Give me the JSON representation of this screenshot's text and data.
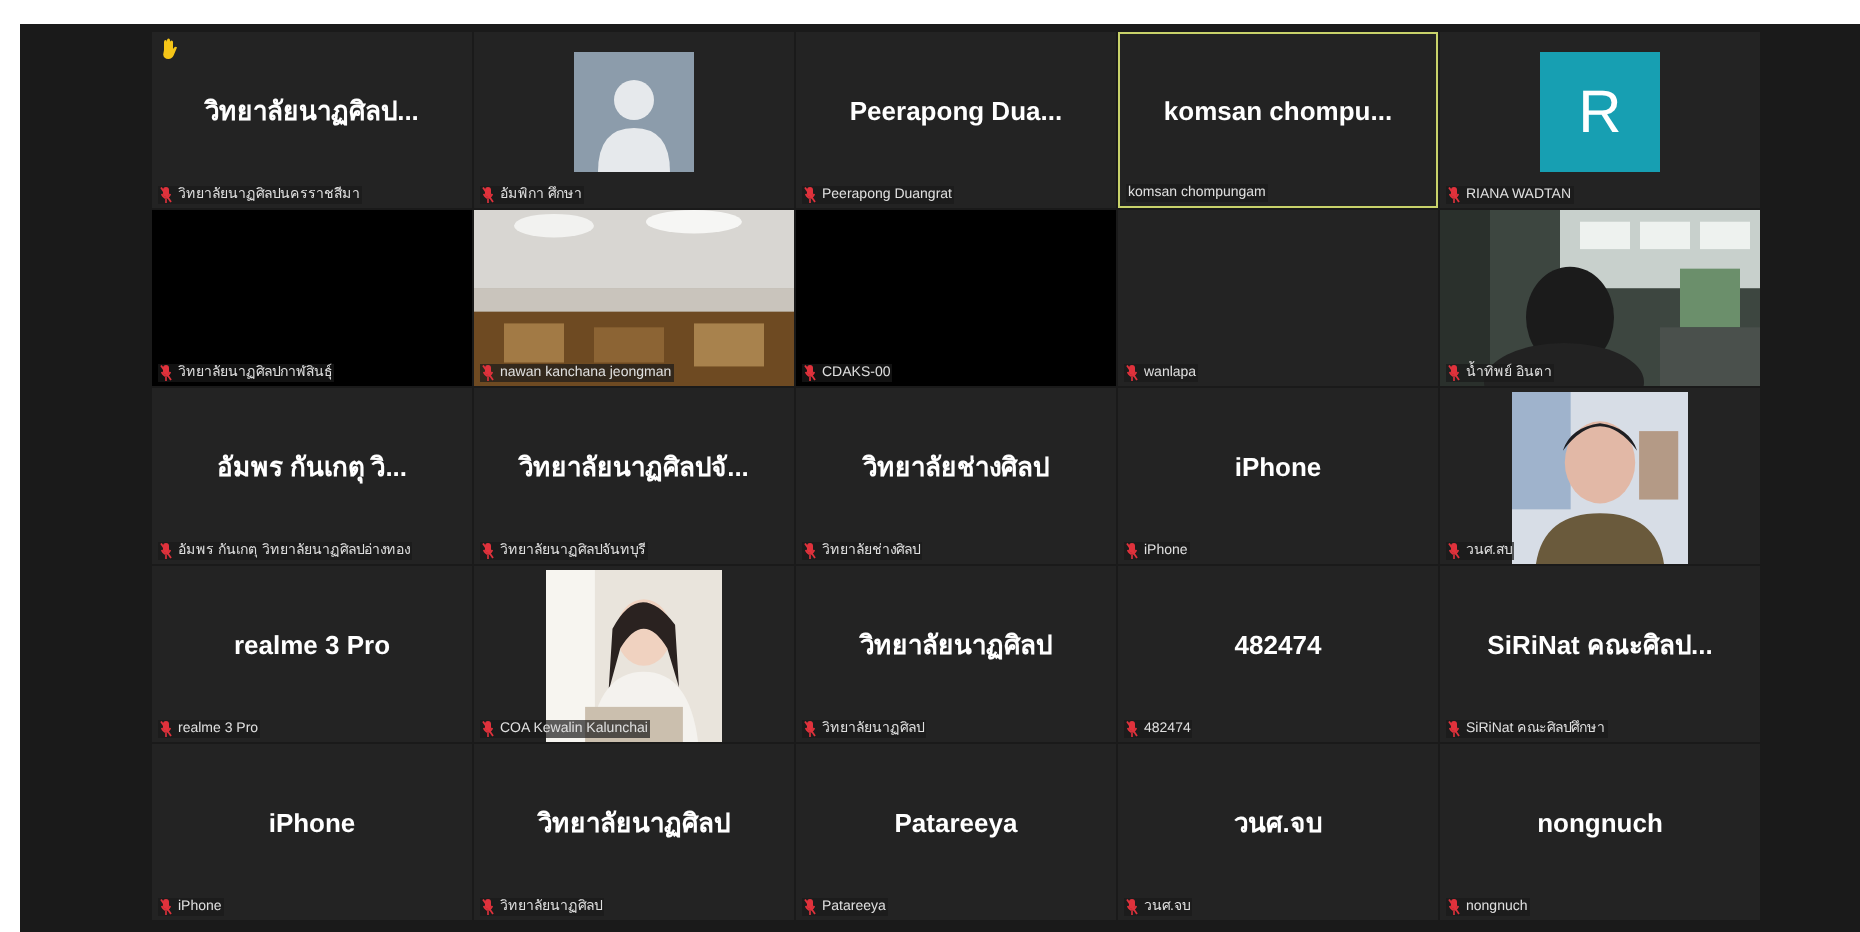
{
  "tiles": [
    {
      "kind": "name",
      "display": "วิทยาลัยนาฏศิลป...",
      "label": "วิทยาลัยนาฏศิลปนครราชสีมา",
      "muted": true,
      "hand_raised": true,
      "speaking": false
    },
    {
      "kind": "avatar",
      "label": "อัมพิกา ศึกษา",
      "muted": true,
      "hand_raised": false,
      "speaking": false
    },
    {
      "kind": "name",
      "display": "Peerapong  Dua...",
      "label": "Peerapong Duangrat",
      "muted": true,
      "hand_raised": false,
      "speaking": false
    },
    {
      "kind": "name",
      "display": "komsan  chompu...",
      "label": "komsan chompungam",
      "muted": false,
      "hand_raised": false,
      "speaking": true
    },
    {
      "kind": "letter",
      "display": "R",
      "label": "RIANA WADTAN",
      "muted": true,
      "hand_raised": false,
      "speaking": false
    },
    {
      "kind": "black",
      "label": "วิทยาลัยนาฏศิลปกาฬสินธุ์",
      "muted": true,
      "hand_raised": false,
      "speaking": false
    },
    {
      "kind": "video",
      "label": "nawan kanchana jeongman",
      "muted": true,
      "hand_raised": false,
      "speaking": false
    },
    {
      "kind": "black",
      "label": "CDAKS-00",
      "muted": true,
      "hand_raised": false,
      "speaking": false
    },
    {
      "kind": "empty",
      "label": "wanlapa",
      "muted": true,
      "hand_raised": false,
      "speaking": false
    },
    {
      "kind": "video-person",
      "label": "น้ำทิพย์ อินตา",
      "muted": true,
      "hand_raised": false,
      "speaking": false
    },
    {
      "kind": "name",
      "display": "อัมพร  กันเกตุ  วิ...",
      "label": "อัมพร กันเกตุ วิทยาลัยนาฏศิลปอ่างทอง",
      "muted": true,
      "hand_raised": false,
      "speaking": false
    },
    {
      "kind": "name",
      "display": "วิทยาลัยนาฏศิลปจั...",
      "label": "วิทยาลัยนาฏศิลปจันทบุรี",
      "muted": true,
      "hand_raised": false,
      "speaking": false
    },
    {
      "kind": "name",
      "display": "วิทยาลัยช่างศิลป",
      "label": "วิทยาลัยช่างศิลป",
      "muted": true,
      "hand_raised": false,
      "speaking": false
    },
    {
      "kind": "name",
      "display": "iPhone",
      "label": "iPhone",
      "muted": true,
      "hand_raised": false,
      "speaking": false
    },
    {
      "kind": "thumb-person",
      "label": "วนศ.สบ",
      "muted": true,
      "hand_raised": false,
      "speaking": false
    },
    {
      "kind": "name",
      "display": "realme 3 Pro",
      "label": "realme 3 Pro",
      "muted": true,
      "hand_raised": false,
      "speaking": false
    },
    {
      "kind": "thumb-photo",
      "label": "COA Kewalin Kalunchai",
      "muted": true,
      "hand_raised": false,
      "speaking": false
    },
    {
      "kind": "name",
      "display": "วิทยาลัยนาฏศิลป",
      "label": "วิทยาลัยนาฏศิลป",
      "muted": true,
      "hand_raised": false,
      "speaking": false
    },
    {
      "kind": "name",
      "display": "482474",
      "label": "482474",
      "muted": true,
      "hand_raised": false,
      "speaking": false
    },
    {
      "kind": "name",
      "display": "SiRiNat คณะศิลป...",
      "label": "SiRiNat คณะศิลปศึกษา",
      "muted": true,
      "hand_raised": false,
      "speaking": false
    },
    {
      "kind": "name",
      "display": "iPhone",
      "label": "iPhone",
      "muted": true,
      "hand_raised": false,
      "speaking": false
    },
    {
      "kind": "name",
      "display": "วิทยาลัยนาฏศิลป",
      "label": "วิทยาลัยนาฏศิลป",
      "muted": true,
      "hand_raised": false,
      "speaking": false
    },
    {
      "kind": "name",
      "display": "Patareeya",
      "label": "Patareeya",
      "muted": true,
      "hand_raised": false,
      "speaking": false
    },
    {
      "kind": "name",
      "display": "วนศ.จบ",
      "label": "วนศ.จบ",
      "muted": true,
      "hand_raised": false,
      "speaking": false
    },
    {
      "kind": "name",
      "display": "nongnuch",
      "label": "nongnuch",
      "muted": true,
      "hand_raised": false,
      "speaking": false
    }
  ]
}
